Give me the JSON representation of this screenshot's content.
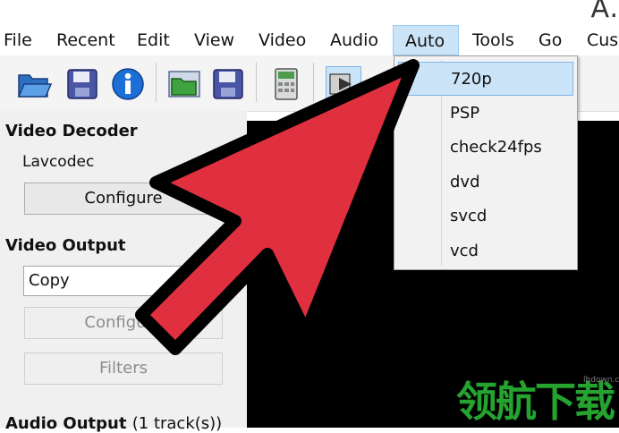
{
  "window": {
    "title_fragment": "A."
  },
  "menubar": {
    "items": [
      "File",
      "Recent",
      "Edit",
      "View",
      "Video",
      "Audio",
      "Auto",
      "Tools",
      "Go",
      "Cust"
    ]
  },
  "auto_menu": {
    "items": [
      "720p",
      "PSP",
      "check24fps",
      "dvd",
      "svcd",
      "vcd"
    ],
    "highlighted": "720p"
  },
  "left_panel": {
    "video_decoder": {
      "heading": "Video Decoder",
      "codec": "Lavcodec",
      "configure_label": "Configure"
    },
    "video_output": {
      "heading": "Video Output",
      "selected": "Copy",
      "configure_label": "Configure",
      "filters_label": "Filters"
    },
    "audio_output": {
      "heading": "Audio Output",
      "tracks": "(1 track(s))"
    }
  },
  "toolbar": {
    "icons": [
      "open-folder-icon",
      "save-icon",
      "info-icon",
      "open-folder-icon",
      "save-icon",
      "calculator-icon",
      "play-icon"
    ]
  },
  "watermark": {
    "text": "领航下载",
    "site": "lhdown.com"
  },
  "colors": {
    "arrow_fill": "#e03040",
    "menu_highlight": "#cce4f7",
    "watermark_green": "#25a32f"
  }
}
